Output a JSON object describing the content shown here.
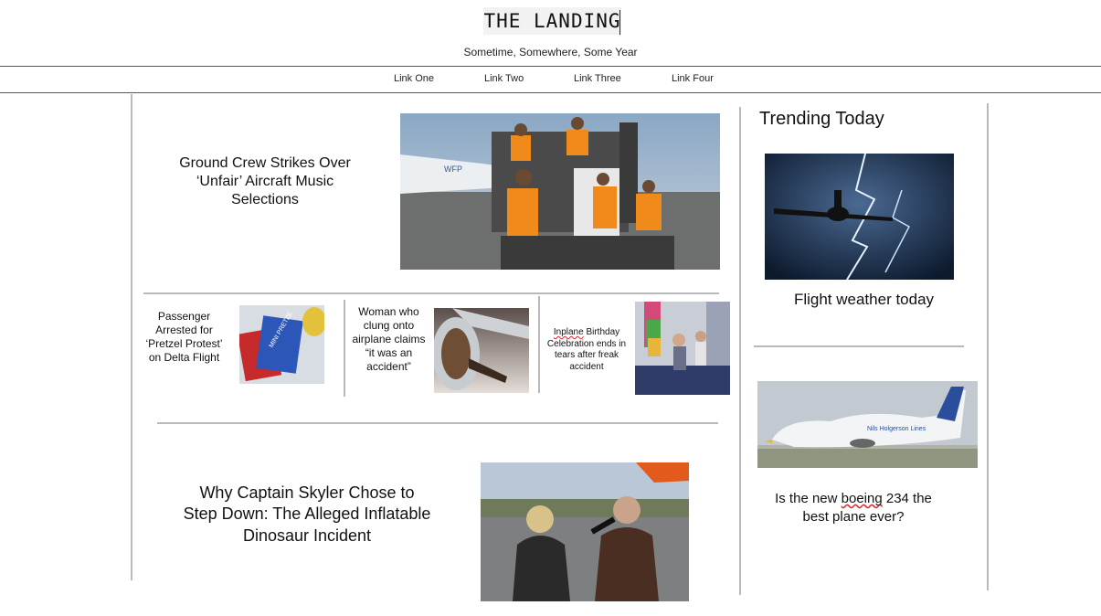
{
  "header": {
    "site_title": "THE LANDING",
    "tagline": "Sometime, Somewhere, Some Year"
  },
  "nav": {
    "links": [
      "Link One",
      "Link Two",
      "Link Three",
      "Link Four"
    ]
  },
  "main": {
    "lead_story": {
      "headline": "Ground Crew Strikes Over ‘Unfair’ Aircraft Music Selections",
      "image_text": "WFP"
    },
    "small_stories": [
      {
        "headline": "Passenger Arrested for ‘Pretzel Protest’ on Delta Flight",
        "image_text": "MINI PRETZE"
      },
      {
        "headline": "Woman who clung onto airplane claims “it was an accident”"
      },
      {
        "headline_word1": "Inplane",
        "headline_rest": " Birthday Celebration ends in tears after freak accident"
      }
    ],
    "bottom_story": {
      "headline": "Why Captain Skyler Chose to Step Down: The Alleged Inflatable Dinosaur Incident"
    }
  },
  "sidebar": {
    "title": "Trending Today",
    "items": [
      {
        "caption": "Flight weather today"
      },
      {
        "caption_before": "Is the new ",
        "caption_squiggle": "boeing",
        "caption_after": " 234 the best plane ever?",
        "image_text": "Nils Holgerson Lines"
      }
    ]
  }
}
